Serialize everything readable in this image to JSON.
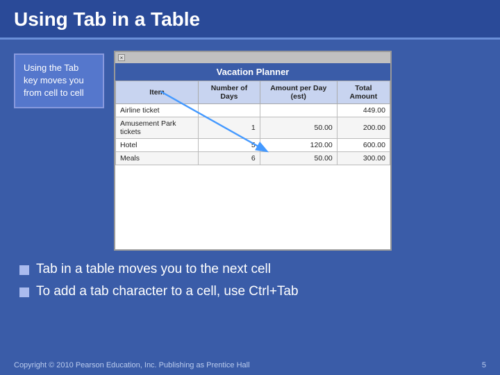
{
  "title": "Using Tab in a Table",
  "caption": {
    "text": "Using the Tab key moves you from cell to cell"
  },
  "table": {
    "window_title": "",
    "vacation_title": "Vacation Planner",
    "headers": [
      "Item",
      "Number of Days",
      "Amount per Day (est)",
      "Total Amount"
    ],
    "rows": [
      {
        "item": "Airline ticket",
        "days": "",
        "amount": "",
        "total": "449.00"
      },
      {
        "item": "Amusement Park tickets",
        "days": "1",
        "amount": "50.00",
        "total": "200.00"
      },
      {
        "item": "Hotel",
        "days": "5",
        "amount": "120.00",
        "total": "600.00"
      },
      {
        "item": "Meals",
        "days": "6",
        "amount": "50.00",
        "total": "300.00"
      }
    ]
  },
  "bullets": [
    "Tab in a table moves you to the next cell",
    "To add a tab character to a cell, use Ctrl+Tab"
  ],
  "footer": {
    "copyright": "Copyright © 2010 Pearson Education, Inc. Publishing as Prentice Hall",
    "page": "5"
  }
}
